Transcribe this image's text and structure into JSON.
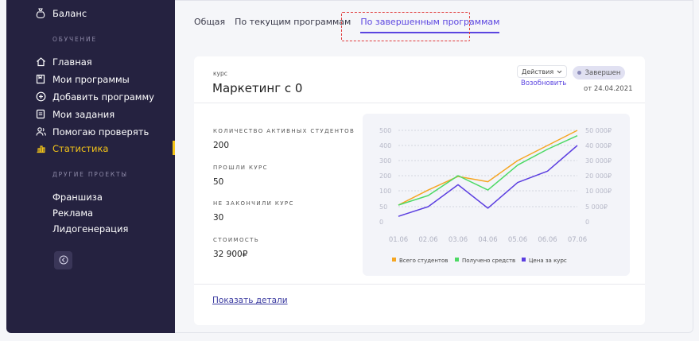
{
  "sidebar": {
    "balance_label": "Баланс",
    "section_learning": "ОБУЧЕНИЕ",
    "items": [
      {
        "label": "Главная",
        "icon": "home-icon"
      },
      {
        "label": "Мои программы",
        "icon": "bookmark-icon"
      },
      {
        "label": "Добавить программу",
        "icon": "plus-circle-icon"
      },
      {
        "label": "Мои задания",
        "icon": "task-icon"
      },
      {
        "label": "Помогаю проверять",
        "icon": "users-icon"
      },
      {
        "label": "Статистика",
        "icon": "chart-icon"
      }
    ],
    "section_other": "ДРУГИЕ ПРОЕКТЫ",
    "other_items": [
      "Франшиза",
      "Реклама",
      "Лидогенерация"
    ],
    "active_color": "#f5c518"
  },
  "tabs": [
    "Общая",
    "По текущим программам",
    "По завершенным программам"
  ],
  "card": {
    "label": "курс",
    "title": "Маркетинг с 0",
    "actions_label": "Действия",
    "renew_label": "Возобновить",
    "status": "Завершен",
    "date": "от 24.04.2021",
    "stats": [
      {
        "label": "КОЛИЧЕСТВО АКТИВНЫХ СТУДЕНТОВ",
        "value": "200"
      },
      {
        "label": "ПРОШЛИ КУРС",
        "value": "50"
      },
      {
        "label": "НЕ ЗАКОНЧИЛИ КУРС",
        "value": "30"
      },
      {
        "label": "СТОИМОСТЬ",
        "value": "32 900₽"
      }
    ],
    "show_details": "Показать детали"
  },
  "chart_data": {
    "type": "line",
    "x": [
      "01.06",
      "02.06",
      "03.06",
      "04.06",
      "05.06",
      "06.06",
      "07.06"
    ],
    "left_ticks": [
      "500",
      "400",
      "300",
      "200",
      "100",
      "50",
      "0"
    ],
    "right_ticks": [
      "50 000₽",
      "40 000₽",
      "30 000₽",
      "20 000₽",
      "10 000₽",
      "5 000₽",
      "0"
    ],
    "series": [
      {
        "name": "Всего студентов",
        "color": "#f5a623",
        "values": [
          55,
          105,
          195,
          160,
          300,
          400,
          500
        ]
      },
      {
        "name": "Получено средств",
        "color": "#4cd964",
        "values": [
          55,
          85,
          200,
          105,
          270,
          375,
          465
        ]
      },
      {
        "name": "Цена за курс",
        "color": "#5b3ee0",
        "values": [
          18,
          50,
          140,
          45,
          155,
          230,
          400
        ]
      }
    ],
    "grid": true,
    "legend": "bottom"
  }
}
